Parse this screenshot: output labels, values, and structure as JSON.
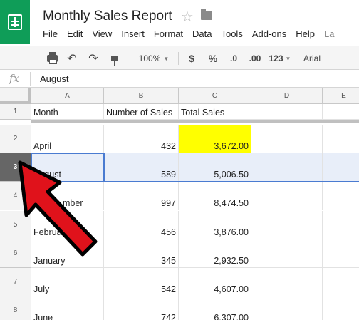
{
  "header": {
    "title": "Monthly Sales Report",
    "star_icon": "star-icon",
    "folder_icon": "folder-icon"
  },
  "menubar": {
    "items": [
      "File",
      "Edit",
      "View",
      "Insert",
      "Format",
      "Data",
      "Tools",
      "Add-ons",
      "Help",
      "La"
    ]
  },
  "toolbar": {
    "zoom": "100%",
    "currency": "$",
    "percent": "%",
    "decrease_decimals": ".0",
    "increase_decimals": ".00",
    "more_formats": "123",
    "font": "Arial"
  },
  "formula_bar": {
    "fx": "fx",
    "value": "August"
  },
  "grid": {
    "columns": [
      "A",
      "B",
      "C",
      "D",
      "E"
    ],
    "rows": [
      {
        "num": "1",
        "a": "Month",
        "b": "Number of Sales",
        "c": "Total Sales"
      },
      {
        "num": "2",
        "a": "April",
        "b": "432",
        "c": "3,672.00"
      },
      {
        "num": "3",
        "a": "August",
        "b": "589",
        "c": "5,006.50"
      },
      {
        "num": "4",
        "a": "mber",
        "b": "997",
        "c": "8,474.50"
      },
      {
        "num": "5",
        "a": "February",
        "b": "456",
        "c": "3,876.00"
      },
      {
        "num": "6",
        "a": "January",
        "b": "345",
        "c": "2,932.50"
      },
      {
        "num": "7",
        "a": "July",
        "b": "542",
        "c": "4,607.00"
      },
      {
        "num": "8",
        "a": "June",
        "b": "742",
        "c": "6,307.00"
      }
    ],
    "selected_row": "3",
    "highlight_color": "#ffff00",
    "selection_color": "#4a7bd1"
  },
  "annotation": {
    "arrow_color": "#e0121b"
  }
}
